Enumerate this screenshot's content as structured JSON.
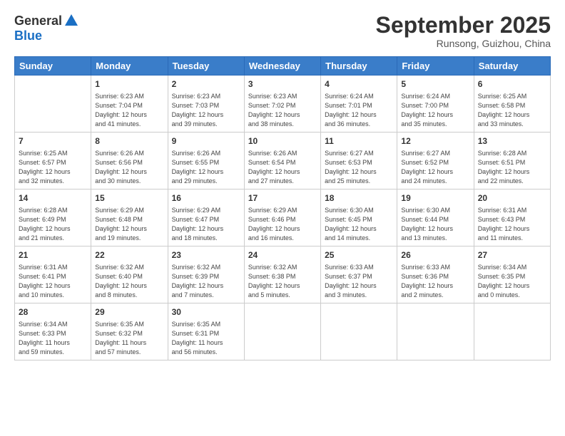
{
  "header": {
    "logo_general": "General",
    "logo_blue": "Blue",
    "month": "September 2025",
    "location": "Runsong, Guizhou, China"
  },
  "weekdays": [
    "Sunday",
    "Monday",
    "Tuesday",
    "Wednesday",
    "Thursday",
    "Friday",
    "Saturday"
  ],
  "weeks": [
    [
      {
        "day": "",
        "info": ""
      },
      {
        "day": "1",
        "info": "Sunrise: 6:23 AM\nSunset: 7:04 PM\nDaylight: 12 hours\nand 41 minutes."
      },
      {
        "day": "2",
        "info": "Sunrise: 6:23 AM\nSunset: 7:03 PM\nDaylight: 12 hours\nand 39 minutes."
      },
      {
        "day": "3",
        "info": "Sunrise: 6:23 AM\nSunset: 7:02 PM\nDaylight: 12 hours\nand 38 minutes."
      },
      {
        "day": "4",
        "info": "Sunrise: 6:24 AM\nSunset: 7:01 PM\nDaylight: 12 hours\nand 36 minutes."
      },
      {
        "day": "5",
        "info": "Sunrise: 6:24 AM\nSunset: 7:00 PM\nDaylight: 12 hours\nand 35 minutes."
      },
      {
        "day": "6",
        "info": "Sunrise: 6:25 AM\nSunset: 6:58 PM\nDaylight: 12 hours\nand 33 minutes."
      }
    ],
    [
      {
        "day": "7",
        "info": "Sunrise: 6:25 AM\nSunset: 6:57 PM\nDaylight: 12 hours\nand 32 minutes."
      },
      {
        "day": "8",
        "info": "Sunrise: 6:26 AM\nSunset: 6:56 PM\nDaylight: 12 hours\nand 30 minutes."
      },
      {
        "day": "9",
        "info": "Sunrise: 6:26 AM\nSunset: 6:55 PM\nDaylight: 12 hours\nand 29 minutes."
      },
      {
        "day": "10",
        "info": "Sunrise: 6:26 AM\nSunset: 6:54 PM\nDaylight: 12 hours\nand 27 minutes."
      },
      {
        "day": "11",
        "info": "Sunrise: 6:27 AM\nSunset: 6:53 PM\nDaylight: 12 hours\nand 25 minutes."
      },
      {
        "day": "12",
        "info": "Sunrise: 6:27 AM\nSunset: 6:52 PM\nDaylight: 12 hours\nand 24 minutes."
      },
      {
        "day": "13",
        "info": "Sunrise: 6:28 AM\nSunset: 6:51 PM\nDaylight: 12 hours\nand 22 minutes."
      }
    ],
    [
      {
        "day": "14",
        "info": "Sunrise: 6:28 AM\nSunset: 6:49 PM\nDaylight: 12 hours\nand 21 minutes."
      },
      {
        "day": "15",
        "info": "Sunrise: 6:29 AM\nSunset: 6:48 PM\nDaylight: 12 hours\nand 19 minutes."
      },
      {
        "day": "16",
        "info": "Sunrise: 6:29 AM\nSunset: 6:47 PM\nDaylight: 12 hours\nand 18 minutes."
      },
      {
        "day": "17",
        "info": "Sunrise: 6:29 AM\nSunset: 6:46 PM\nDaylight: 12 hours\nand 16 minutes."
      },
      {
        "day": "18",
        "info": "Sunrise: 6:30 AM\nSunset: 6:45 PM\nDaylight: 12 hours\nand 14 minutes."
      },
      {
        "day": "19",
        "info": "Sunrise: 6:30 AM\nSunset: 6:44 PM\nDaylight: 12 hours\nand 13 minutes."
      },
      {
        "day": "20",
        "info": "Sunrise: 6:31 AM\nSunset: 6:43 PM\nDaylight: 12 hours\nand 11 minutes."
      }
    ],
    [
      {
        "day": "21",
        "info": "Sunrise: 6:31 AM\nSunset: 6:41 PM\nDaylight: 12 hours\nand 10 minutes."
      },
      {
        "day": "22",
        "info": "Sunrise: 6:32 AM\nSunset: 6:40 PM\nDaylight: 12 hours\nand 8 minutes."
      },
      {
        "day": "23",
        "info": "Sunrise: 6:32 AM\nSunset: 6:39 PM\nDaylight: 12 hours\nand 7 minutes."
      },
      {
        "day": "24",
        "info": "Sunrise: 6:32 AM\nSunset: 6:38 PM\nDaylight: 12 hours\nand 5 minutes."
      },
      {
        "day": "25",
        "info": "Sunrise: 6:33 AM\nSunset: 6:37 PM\nDaylight: 12 hours\nand 3 minutes."
      },
      {
        "day": "26",
        "info": "Sunrise: 6:33 AM\nSunset: 6:36 PM\nDaylight: 12 hours\nand 2 minutes."
      },
      {
        "day": "27",
        "info": "Sunrise: 6:34 AM\nSunset: 6:35 PM\nDaylight: 12 hours\nand 0 minutes."
      }
    ],
    [
      {
        "day": "28",
        "info": "Sunrise: 6:34 AM\nSunset: 6:33 PM\nDaylight: 11 hours\nand 59 minutes."
      },
      {
        "day": "29",
        "info": "Sunrise: 6:35 AM\nSunset: 6:32 PM\nDaylight: 11 hours\nand 57 minutes."
      },
      {
        "day": "30",
        "info": "Sunrise: 6:35 AM\nSunset: 6:31 PM\nDaylight: 11 hours\nand 56 minutes."
      },
      {
        "day": "",
        "info": ""
      },
      {
        "day": "",
        "info": ""
      },
      {
        "day": "",
        "info": ""
      },
      {
        "day": "",
        "info": ""
      }
    ]
  ]
}
